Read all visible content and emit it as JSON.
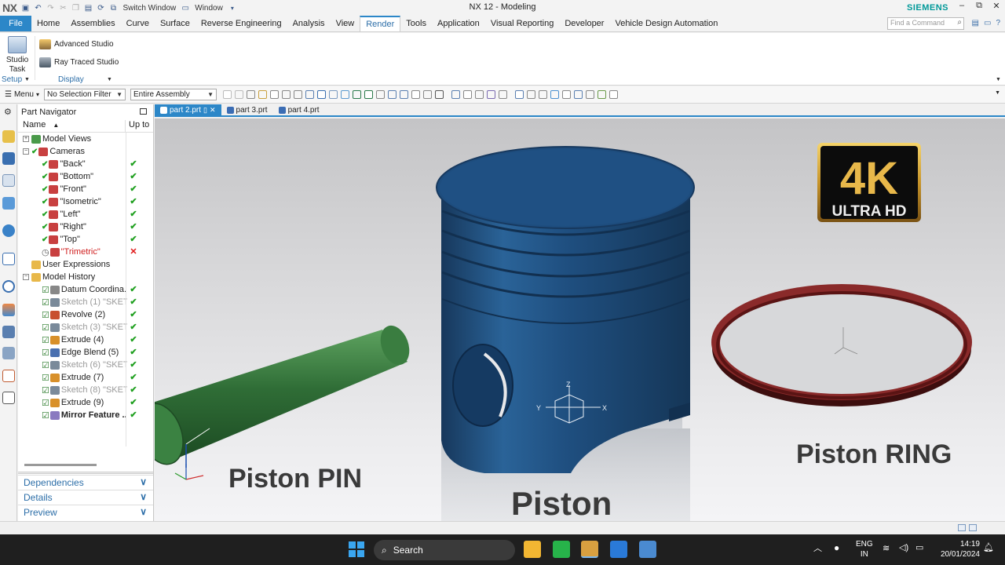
{
  "app": {
    "logo": "NX",
    "window_title": "NX 12 - Modeling",
    "brand": "SIEMENS",
    "switch_window": "Switch Window",
    "window_menu": "Window"
  },
  "menu_tabs": [
    {
      "label": "File",
      "active": false
    },
    {
      "label": "Home",
      "active": false
    },
    {
      "label": "Assemblies",
      "active": false
    },
    {
      "label": "Curve",
      "active": false
    },
    {
      "label": "Surface",
      "active": false
    },
    {
      "label": "Reverse Engineering",
      "active": false
    },
    {
      "label": "Analysis",
      "active": false
    },
    {
      "label": "View",
      "active": false
    },
    {
      "label": "Render",
      "active": true
    },
    {
      "label": "Tools",
      "active": false
    },
    {
      "label": "Application",
      "active": false
    },
    {
      "label": "Visual Reporting",
      "active": false
    },
    {
      "label": "Developer",
      "active": false
    },
    {
      "label": "Vehicle Design Automation",
      "active": false
    }
  ],
  "find_command_placeholder": "Find a Command",
  "ribbon": {
    "studio_task_line1": "Studio",
    "studio_task_line2": "Task",
    "setup_group": "Setup",
    "advanced_studio": "Advanced Studio",
    "ray_traced_studio": "Ray Traced Studio",
    "display_group": "Display"
  },
  "toolbar": {
    "menu": "Menu",
    "selection_filter": "No Selection Filter",
    "scope": "Entire Assembly"
  },
  "navigator": {
    "title": "Part Navigator",
    "col_name": "Name",
    "col_upto": "Up to",
    "rows": [
      {
        "label": "Model Views",
        "indent": 0,
        "expander": "+",
        "icon": "views",
        "status": ""
      },
      {
        "label": "Cameras",
        "indent": 0,
        "expander": "−",
        "icon": "camera",
        "check": true,
        "status": ""
      },
      {
        "label": "\"Back\"",
        "indent": 1,
        "icon": "camera",
        "check": true,
        "status": "ok"
      },
      {
        "label": "\"Bottom\"",
        "indent": 1,
        "icon": "camera",
        "check": true,
        "status": "ok"
      },
      {
        "label": "\"Front\"",
        "indent": 1,
        "icon": "camera",
        "check": true,
        "status": "ok"
      },
      {
        "label": "\"Isometric\"",
        "indent": 1,
        "icon": "camera",
        "check": true,
        "status": "ok"
      },
      {
        "label": "\"Left\"",
        "indent": 1,
        "icon": "camera",
        "check": true,
        "status": "ok"
      },
      {
        "label": "\"Right\"",
        "indent": 1,
        "icon": "camera",
        "check": true,
        "status": "ok"
      },
      {
        "label": "\"Top\"",
        "indent": 1,
        "icon": "camera",
        "check": true,
        "status": "ok"
      },
      {
        "label": "\"Trimetric\"",
        "indent": 1,
        "icon": "camera",
        "check": false,
        "status": "error",
        "style": "red"
      },
      {
        "label": "User Expressions",
        "indent": 0,
        "icon": "folder",
        "status": ""
      },
      {
        "label": "Model History",
        "indent": 0,
        "expander": "−",
        "icon": "folder",
        "status": ""
      },
      {
        "label": "Datum Coordina...",
        "indent": 1,
        "icon": "datum",
        "box": true,
        "status": "ok"
      },
      {
        "label": "Sketch (1) \"SKET...",
        "indent": 1,
        "icon": "sketch",
        "box": true,
        "status": "ok",
        "style": "gray"
      },
      {
        "label": "Revolve (2)",
        "indent": 1,
        "icon": "revolve",
        "box": true,
        "status": "ok"
      },
      {
        "label": "Sketch (3) \"SKET...",
        "indent": 1,
        "icon": "sketch",
        "box": true,
        "status": "ok",
        "style": "gray"
      },
      {
        "label": "Extrude (4)",
        "indent": 1,
        "icon": "extrude",
        "box": true,
        "status": "ok"
      },
      {
        "label": "Edge Blend (5)",
        "indent": 1,
        "icon": "blend",
        "box": true,
        "status": "ok"
      },
      {
        "label": "Sketch (6) \"SKET...",
        "indent": 1,
        "icon": "sketch",
        "box": true,
        "status": "ok",
        "style": "gray"
      },
      {
        "label": "Extrude (7)",
        "indent": 1,
        "icon": "extrude",
        "box": true,
        "status": "ok"
      },
      {
        "label": "Sketch (8) \"SKET...",
        "indent": 1,
        "icon": "sketch",
        "box": true,
        "status": "ok",
        "style": "gray"
      },
      {
        "label": "Extrude (9)",
        "indent": 1,
        "icon": "extrude",
        "box": true,
        "status": "ok"
      },
      {
        "label": "Mirror Feature ...",
        "indent": 1,
        "icon": "mirror",
        "box": true,
        "status": "ok",
        "style": "bold"
      }
    ],
    "dependencies": "Dependencies",
    "details": "Details",
    "preview": "Preview"
  },
  "part_tabs": [
    {
      "label": "part 2.prt",
      "active": true
    },
    {
      "label": "part 3.prt",
      "active": false
    },
    {
      "label": "part 4.prt",
      "active": false
    }
  ],
  "viewport": {
    "label_pin": "Piston PIN",
    "label_piston": "Piston",
    "label_ring": "Piston RING",
    "badge_big": "4K",
    "badge_small": "ULTRA HD",
    "axis_x": "X",
    "axis_y": "Y",
    "axis_z": "Z"
  },
  "taskbar": {
    "search": "Search",
    "lang1": "ENG",
    "lang2": "IN",
    "time": "14:19",
    "date": "20/01/2024"
  },
  "colors": {
    "accent": "#2c87c8",
    "piston": "#1f4f80",
    "pin": "#2e6a34",
    "ring": "#6b1e1e"
  }
}
